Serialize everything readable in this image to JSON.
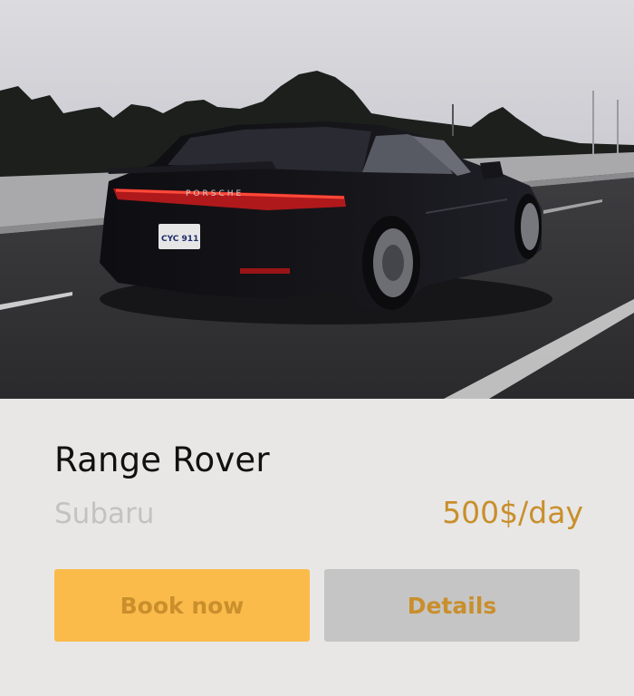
{
  "card": {
    "model": "Range Rover",
    "brand": "Subaru",
    "price": "500$/day",
    "book_label": "Book now",
    "details_label": "Details"
  },
  "photo": {
    "plate_text": "CYC 911",
    "badge_text": "PORSCHE"
  },
  "colors": {
    "accent": "#c98f2c",
    "book_button": "#fbbb4b",
    "details_button": "#c5c5c5",
    "card_background": "#e8e7e6"
  }
}
